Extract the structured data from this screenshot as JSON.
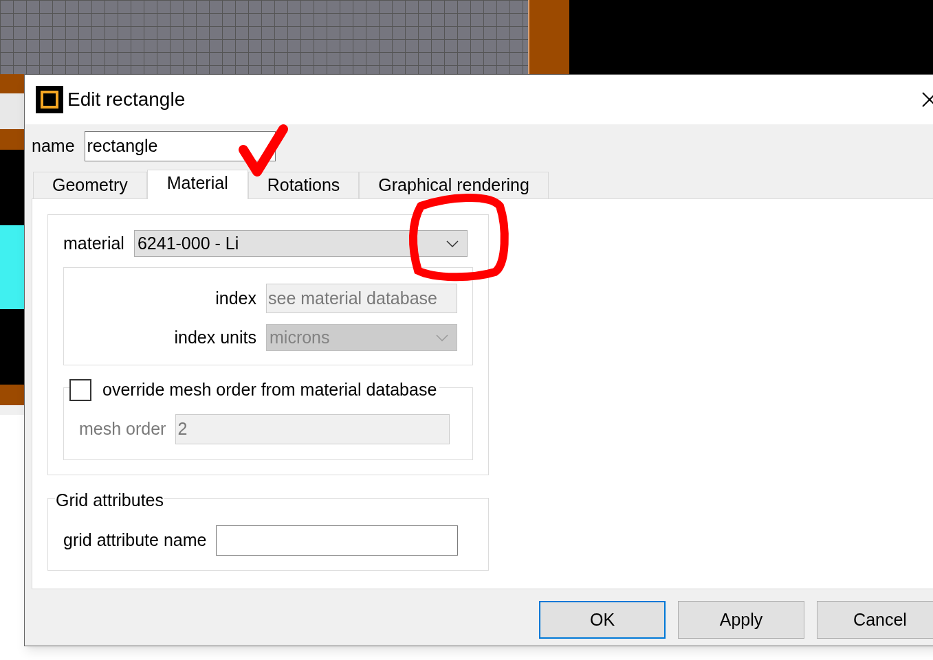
{
  "dialog": {
    "title": "Edit rectangle",
    "name_label": "name",
    "name_value": "rectangle",
    "tabs": [
      {
        "label": "Geometry",
        "selected": false
      },
      {
        "label": "Material",
        "selected": true
      },
      {
        "label": "Rotations",
        "selected": false
      },
      {
        "label": "Graphical rendering",
        "selected": false
      }
    ],
    "material": {
      "label": "material",
      "value": "6241-000 - Li"
    },
    "index": {
      "label": "index",
      "value": "see material database",
      "disabled": true
    },
    "index_units": {
      "label": "index units",
      "value": "microns",
      "disabled": true
    },
    "override": {
      "label": "override mesh order from material database",
      "checked": false
    },
    "mesh_order": {
      "label": "mesh order",
      "value": "2",
      "disabled": true
    },
    "grid_attributes": {
      "title": "Grid attributes",
      "label": "grid attribute name"
    },
    "buttons": [
      {
        "label": "OK",
        "focused": true
      },
      {
        "label": "Apply",
        "focused": false
      },
      {
        "label": "Cancel",
        "focused": false
      }
    ]
  }
}
